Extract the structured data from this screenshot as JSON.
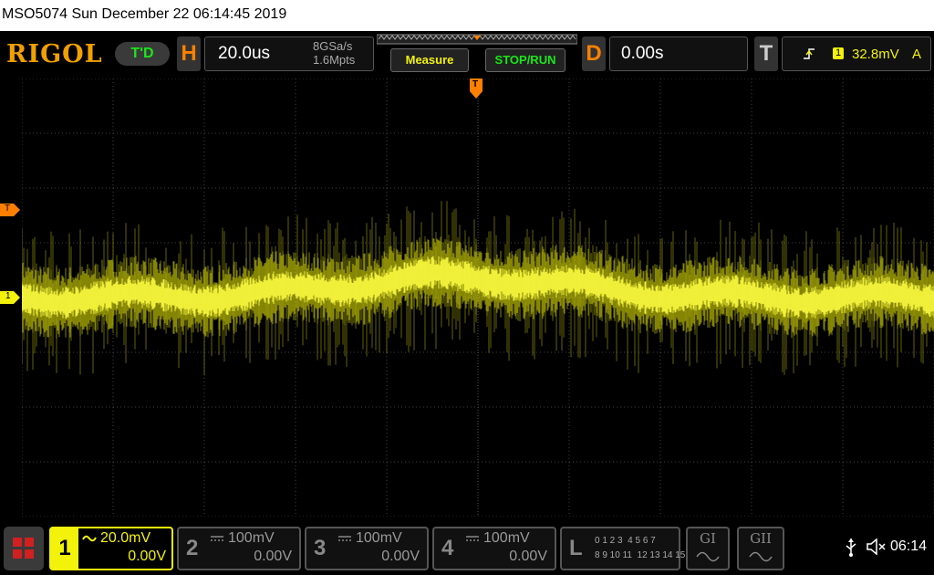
{
  "title": "MSO5074  Sun December 22 06:14:45 2019",
  "brand": "RIGOL",
  "trigger_mode": "T'D",
  "horizontal": {
    "letter": "H",
    "timebase": "20.0us",
    "sample_rate": "8GSa/s",
    "memory_depth": "1.6Mpts"
  },
  "buttons": {
    "measure": "Measure",
    "stop_run": "STOP/RUN"
  },
  "delay": {
    "letter": "D",
    "value": "0.00s"
  },
  "trigger": {
    "letter": "T",
    "source": "1",
    "level": "32.8mV",
    "mode": "A",
    "edge_icon": "rising-edge-icon"
  },
  "markers": {
    "trigger_top": "T",
    "trigger_left": "T",
    "channel1_left": "1"
  },
  "channels": [
    {
      "num": "1",
      "scale": "20.0mV",
      "offset": "0.00V",
      "coupling_icon": "ac-coupling-icon",
      "active": true
    },
    {
      "num": "2",
      "scale": "100mV",
      "offset": "0.00V",
      "coupling_icon": "dc-coupling-icon",
      "active": false
    },
    {
      "num": "3",
      "scale": "100mV",
      "offset": "0.00V",
      "coupling_icon": "dc-coupling-icon",
      "active": false
    },
    {
      "num": "4",
      "scale": "100mV",
      "offset": "0.00V",
      "coupling_icon": "dc-coupling-icon",
      "active": false
    }
  ],
  "logic": {
    "letter": "L",
    "row1": "0 1 2 3  4 5 6 7",
    "row2": "8 9 10 11  12 13 14 15"
  },
  "generators": [
    {
      "label": "GI"
    },
    {
      "label": "GII"
    }
  ],
  "status": {
    "time": "06:14"
  },
  "colors": {
    "ch1": "#f2f20a",
    "accent": "#ff8000",
    "green": "#19e619",
    "grid": "#555555"
  }
}
